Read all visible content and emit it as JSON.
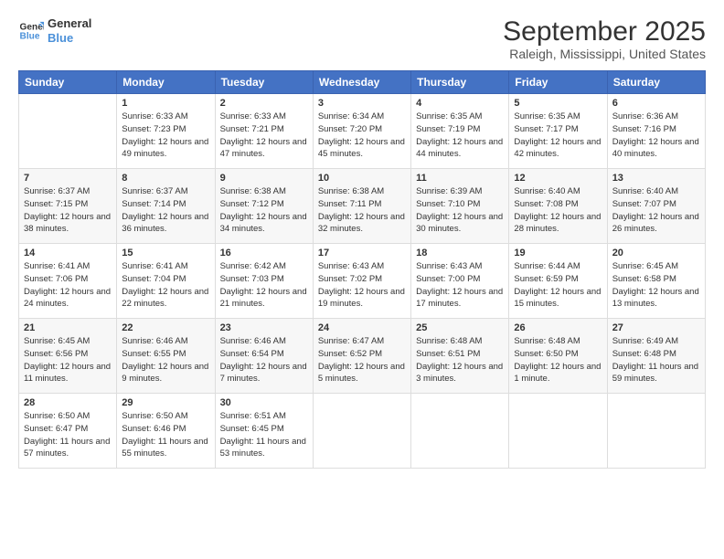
{
  "logo": {
    "line1": "General",
    "line2": "Blue"
  },
  "title": "September 2025",
  "subtitle": "Raleigh, Mississippi, United States",
  "weekdays": [
    "Sunday",
    "Monday",
    "Tuesday",
    "Wednesday",
    "Thursday",
    "Friday",
    "Saturday"
  ],
  "weeks": [
    [
      {
        "day": "",
        "sunrise": "",
        "sunset": "",
        "daylight": ""
      },
      {
        "day": "1",
        "sunrise": "Sunrise: 6:33 AM",
        "sunset": "Sunset: 7:23 PM",
        "daylight": "Daylight: 12 hours and 49 minutes."
      },
      {
        "day": "2",
        "sunrise": "Sunrise: 6:33 AM",
        "sunset": "Sunset: 7:21 PM",
        "daylight": "Daylight: 12 hours and 47 minutes."
      },
      {
        "day": "3",
        "sunrise": "Sunrise: 6:34 AM",
        "sunset": "Sunset: 7:20 PM",
        "daylight": "Daylight: 12 hours and 45 minutes."
      },
      {
        "day": "4",
        "sunrise": "Sunrise: 6:35 AM",
        "sunset": "Sunset: 7:19 PM",
        "daylight": "Daylight: 12 hours and 44 minutes."
      },
      {
        "day": "5",
        "sunrise": "Sunrise: 6:35 AM",
        "sunset": "Sunset: 7:17 PM",
        "daylight": "Daylight: 12 hours and 42 minutes."
      },
      {
        "day": "6",
        "sunrise": "Sunrise: 6:36 AM",
        "sunset": "Sunset: 7:16 PM",
        "daylight": "Daylight: 12 hours and 40 minutes."
      }
    ],
    [
      {
        "day": "7",
        "sunrise": "Sunrise: 6:37 AM",
        "sunset": "Sunset: 7:15 PM",
        "daylight": "Daylight: 12 hours and 38 minutes."
      },
      {
        "day": "8",
        "sunrise": "Sunrise: 6:37 AM",
        "sunset": "Sunset: 7:14 PM",
        "daylight": "Daylight: 12 hours and 36 minutes."
      },
      {
        "day": "9",
        "sunrise": "Sunrise: 6:38 AM",
        "sunset": "Sunset: 7:12 PM",
        "daylight": "Daylight: 12 hours and 34 minutes."
      },
      {
        "day": "10",
        "sunrise": "Sunrise: 6:38 AM",
        "sunset": "Sunset: 7:11 PM",
        "daylight": "Daylight: 12 hours and 32 minutes."
      },
      {
        "day": "11",
        "sunrise": "Sunrise: 6:39 AM",
        "sunset": "Sunset: 7:10 PM",
        "daylight": "Daylight: 12 hours and 30 minutes."
      },
      {
        "day": "12",
        "sunrise": "Sunrise: 6:40 AM",
        "sunset": "Sunset: 7:08 PM",
        "daylight": "Daylight: 12 hours and 28 minutes."
      },
      {
        "day": "13",
        "sunrise": "Sunrise: 6:40 AM",
        "sunset": "Sunset: 7:07 PM",
        "daylight": "Daylight: 12 hours and 26 minutes."
      }
    ],
    [
      {
        "day": "14",
        "sunrise": "Sunrise: 6:41 AM",
        "sunset": "Sunset: 7:06 PM",
        "daylight": "Daylight: 12 hours and 24 minutes."
      },
      {
        "day": "15",
        "sunrise": "Sunrise: 6:41 AM",
        "sunset": "Sunset: 7:04 PM",
        "daylight": "Daylight: 12 hours and 22 minutes."
      },
      {
        "day": "16",
        "sunrise": "Sunrise: 6:42 AM",
        "sunset": "Sunset: 7:03 PM",
        "daylight": "Daylight: 12 hours and 21 minutes."
      },
      {
        "day": "17",
        "sunrise": "Sunrise: 6:43 AM",
        "sunset": "Sunset: 7:02 PM",
        "daylight": "Daylight: 12 hours and 19 minutes."
      },
      {
        "day": "18",
        "sunrise": "Sunrise: 6:43 AM",
        "sunset": "Sunset: 7:00 PM",
        "daylight": "Daylight: 12 hours and 17 minutes."
      },
      {
        "day": "19",
        "sunrise": "Sunrise: 6:44 AM",
        "sunset": "Sunset: 6:59 PM",
        "daylight": "Daylight: 12 hours and 15 minutes."
      },
      {
        "day": "20",
        "sunrise": "Sunrise: 6:45 AM",
        "sunset": "Sunset: 6:58 PM",
        "daylight": "Daylight: 12 hours and 13 minutes."
      }
    ],
    [
      {
        "day": "21",
        "sunrise": "Sunrise: 6:45 AM",
        "sunset": "Sunset: 6:56 PM",
        "daylight": "Daylight: 12 hours and 11 minutes."
      },
      {
        "day": "22",
        "sunrise": "Sunrise: 6:46 AM",
        "sunset": "Sunset: 6:55 PM",
        "daylight": "Daylight: 12 hours and 9 minutes."
      },
      {
        "day": "23",
        "sunrise": "Sunrise: 6:46 AM",
        "sunset": "Sunset: 6:54 PM",
        "daylight": "Daylight: 12 hours and 7 minutes."
      },
      {
        "day": "24",
        "sunrise": "Sunrise: 6:47 AM",
        "sunset": "Sunset: 6:52 PM",
        "daylight": "Daylight: 12 hours and 5 minutes."
      },
      {
        "day": "25",
        "sunrise": "Sunrise: 6:48 AM",
        "sunset": "Sunset: 6:51 PM",
        "daylight": "Daylight: 12 hours and 3 minutes."
      },
      {
        "day": "26",
        "sunrise": "Sunrise: 6:48 AM",
        "sunset": "Sunset: 6:50 PM",
        "daylight": "Daylight: 12 hours and 1 minute."
      },
      {
        "day": "27",
        "sunrise": "Sunrise: 6:49 AM",
        "sunset": "Sunset: 6:48 PM",
        "daylight": "Daylight: 11 hours and 59 minutes."
      }
    ],
    [
      {
        "day": "28",
        "sunrise": "Sunrise: 6:50 AM",
        "sunset": "Sunset: 6:47 PM",
        "daylight": "Daylight: 11 hours and 57 minutes."
      },
      {
        "day": "29",
        "sunrise": "Sunrise: 6:50 AM",
        "sunset": "Sunset: 6:46 PM",
        "daylight": "Daylight: 11 hours and 55 minutes."
      },
      {
        "day": "30",
        "sunrise": "Sunrise: 6:51 AM",
        "sunset": "Sunset: 6:45 PM",
        "daylight": "Daylight: 11 hours and 53 minutes."
      },
      {
        "day": "",
        "sunrise": "",
        "sunset": "",
        "daylight": ""
      },
      {
        "day": "",
        "sunrise": "",
        "sunset": "",
        "daylight": ""
      },
      {
        "day": "",
        "sunrise": "",
        "sunset": "",
        "daylight": ""
      },
      {
        "day": "",
        "sunrise": "",
        "sunset": "",
        "daylight": ""
      }
    ]
  ]
}
